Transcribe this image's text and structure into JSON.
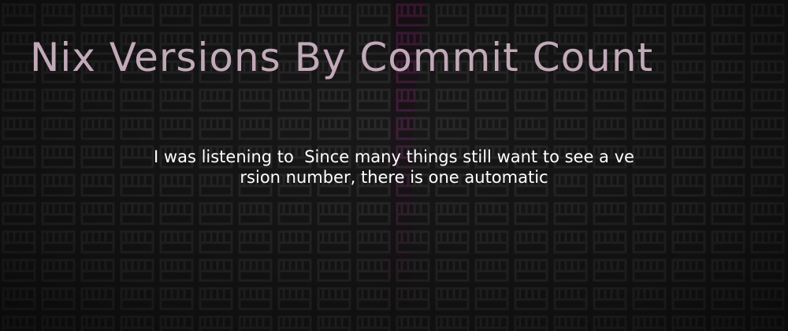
{
  "card": {
    "title": "Nix Versions By Commit Count",
    "excerpt_lines": [
      "I was listening to  Since many things still want to see a ve",
      "rsion number, there is one automatic"
    ]
  },
  "colors": {
    "background": "#1a1a1a",
    "tile": "#262626",
    "tile_highlight": "#4a1b3f",
    "title": "#c2a9b8",
    "excerpt": "#ffffff"
  }
}
